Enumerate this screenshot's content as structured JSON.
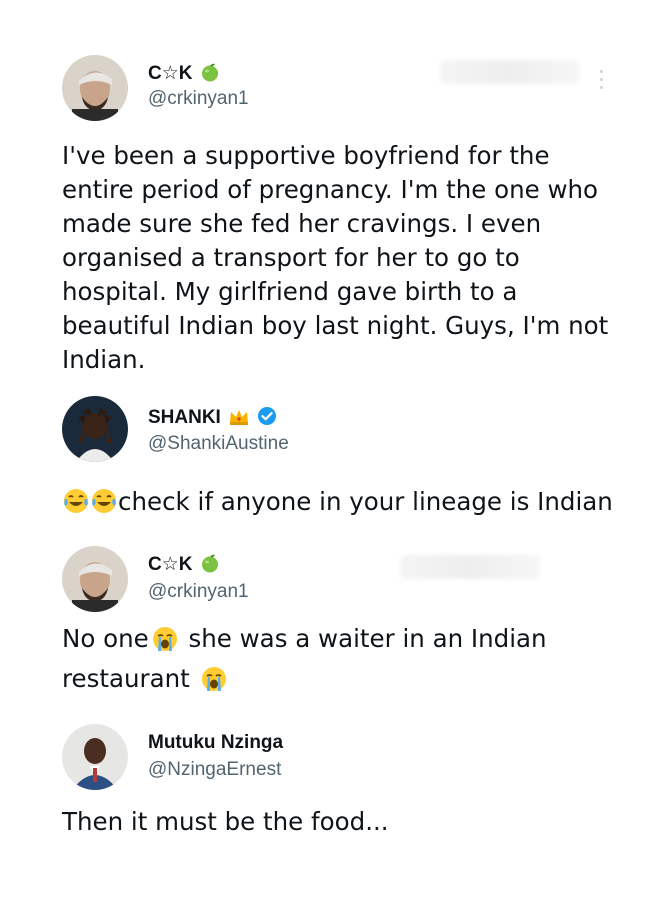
{
  "posts": [
    {
      "display_name": "C☆K",
      "name_emoji": "green-apple-icon",
      "handle": "@crkinyan1",
      "text": "I've been a supportive boyfriend for the entire period of pregnancy. I'm the one who made sure she fed her cravings. I even organised a transport for her to go to hospital. My girlfriend gave birth to a beautiful Indian boy last night. Guys, I'm not Indian."
    },
    {
      "display_name": "SHANKI",
      "name_emoji": "crown-icon",
      "verified": true,
      "handle": "@ShankiAustine",
      "text_emojis": "face-with-tears-of-joy-icon",
      "text": "check if anyone in your lineage is Indian"
    },
    {
      "display_name": "C☆K",
      "name_emoji": "green-apple-icon",
      "handle": "@crkinyan1",
      "text_part1": "No one",
      "text_part2": " she was a waiter in an Indian restaurant ",
      "text_emojis": "loudly-crying-face-icon"
    },
    {
      "display_name": "Mutuku Nzinga",
      "handle": "@NzingaErnest",
      "text": "Then it must be the food..."
    }
  ],
  "colors": {
    "text": "#0f1419",
    "handle": "#536471",
    "verified": "#1d9bf0"
  }
}
